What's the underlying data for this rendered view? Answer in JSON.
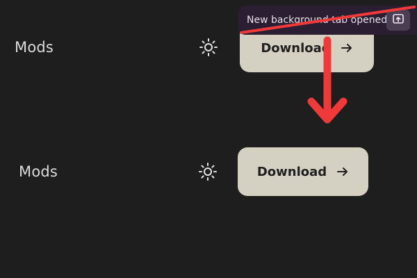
{
  "rows": [
    {
      "label": "Mods",
      "icon": "sun-icon",
      "button_label": "Download",
      "button_icon": "arrow-right-icon"
    },
    {
      "label": "Mods",
      "icon": "sun-icon",
      "button_label": "Download",
      "button_icon": "arrow-right-icon"
    }
  ],
  "toast": {
    "message": "New background tab opened!",
    "action_icon": "open-tab-icon"
  },
  "annotation": {
    "arrow_color": "#f03a3a",
    "strike_color": "#f03a3a"
  },
  "colors": {
    "background": "#1e1e1e",
    "button": "#d4d1c2",
    "toast": "#2a1f32",
    "text": "#dcdcdc"
  }
}
